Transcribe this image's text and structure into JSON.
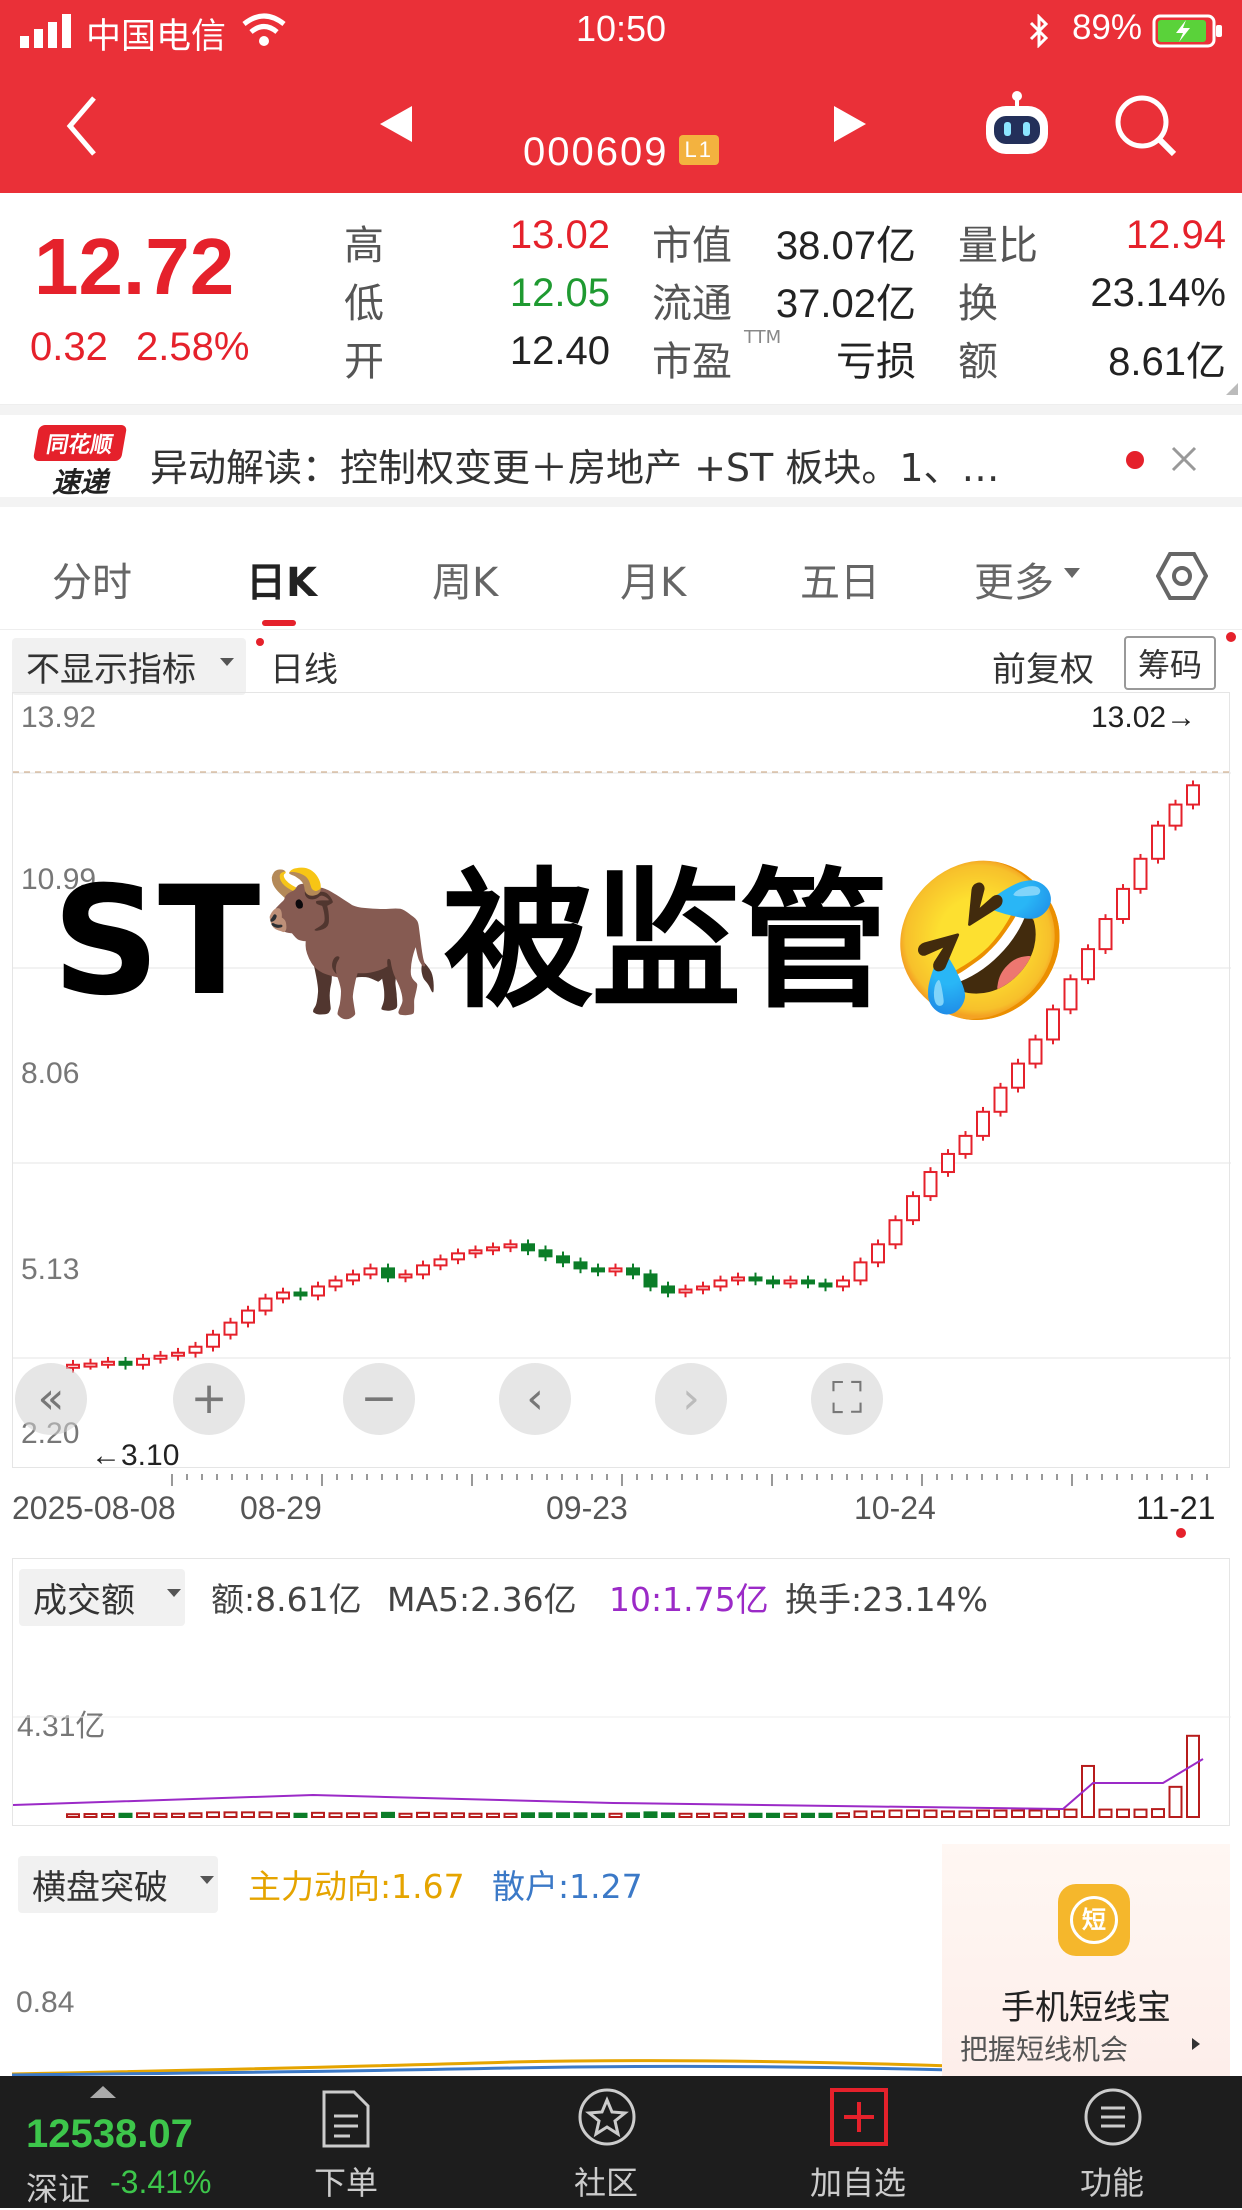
{
  "status_bar": {
    "carrier": "中国电信",
    "time": "10:50",
    "battery": "89%"
  },
  "header": {
    "stock_code": "000609",
    "level_badge": "L1"
  },
  "quote": {
    "price": "12.72",
    "change": "0.32",
    "change_pct": "2.58%",
    "high_label": "高",
    "high": "13.02",
    "low_label": "低",
    "low": "12.05",
    "open_label": "开",
    "open": "12.40",
    "mktcap_label": "市值",
    "mktcap": "38.07亿",
    "float_label": "流通",
    "float": "37.02亿",
    "pe_label": "市盈",
    "pe_sup": "TTM",
    "pe": "亏损",
    "vr_label": "量比",
    "vr": "12.94",
    "turnover_label": "换",
    "turnover": "23.14%",
    "amount_label": "额",
    "amount": "8.61亿"
  },
  "news": {
    "logo_top": "同花顺",
    "logo_bottom": "速递",
    "text": "异动解读：控制权变更＋房地产 +ST 板块。1、…"
  },
  "tabs": [
    "分时",
    "日K",
    "周K",
    "月K",
    "五日",
    "更多"
  ],
  "kline": {
    "indicator_select": "不显示指标",
    "period": "日线",
    "adjust": "前复权",
    "chips": "筹码",
    "y_labels": [
      "13.92",
      "10.99",
      "8.06",
      "5.13",
      "2.20"
    ],
    "max_label": "13.02→",
    "min_label": "←3.10",
    "dates": [
      "2025-08-08",
      "08-29",
      "09-23",
      "10-24",
      "11-21"
    ]
  },
  "overlay": {
    "text": "ST🐂被监管🤣"
  },
  "volume": {
    "select": "成交额",
    "amount": "额:8.61亿",
    "ma5": "MA5:2.36亿",
    "ma10": "10:1.75亿",
    "turnover": "换手:23.14%",
    "y_label": "4.31亿"
  },
  "indicator": {
    "select": "横盘突破",
    "main_force": "主力动向:1.67",
    "retail": "散户:1.27",
    "y_label": "0.84",
    "ad_title": "手机短线宝",
    "ad_sub": "把握短线机会",
    "ad_icon": "短"
  },
  "bottom": {
    "index_value": "12538.07",
    "index_name": "深证",
    "index_change": "-3.41%",
    "items": [
      "下单",
      "社区",
      "加自选",
      "功能"
    ]
  },
  "colors": {
    "brand_red": "#ea3038",
    "up": "#e5212b",
    "down": "#1f9a31"
  },
  "chart_data": {
    "type": "candlestick",
    "y_range": [
      2.2,
      13.92
    ],
    "x_range": [
      "2025-08-08",
      "11-21"
    ],
    "max": 13.02,
    "min": 3.1,
    "closes": [
      3.1,
      3.12,
      3.15,
      3.1,
      3.2,
      3.25,
      3.3,
      3.4,
      3.6,
      3.8,
      4.0,
      4.2,
      4.3,
      4.25,
      4.4,
      4.5,
      4.6,
      4.7,
      4.55,
      4.6,
      4.75,
      4.85,
      4.95,
      5.0,
      5.05,
      5.1,
      5.0,
      4.9,
      4.8,
      4.7,
      4.65,
      4.7,
      4.6,
      4.4,
      4.3,
      4.35,
      4.4,
      4.5,
      4.55,
      4.5,
      4.45,
      4.5,
      4.45,
      4.4,
      4.5,
      4.8,
      5.1,
      5.5,
      5.9,
      6.3,
      6.6,
      6.9,
      7.3,
      7.7,
      8.1,
      8.5,
      9.0,
      9.5,
      10.0,
      10.5,
      11.0,
      11.5,
      12.05,
      12.4,
      12.72
    ]
  }
}
